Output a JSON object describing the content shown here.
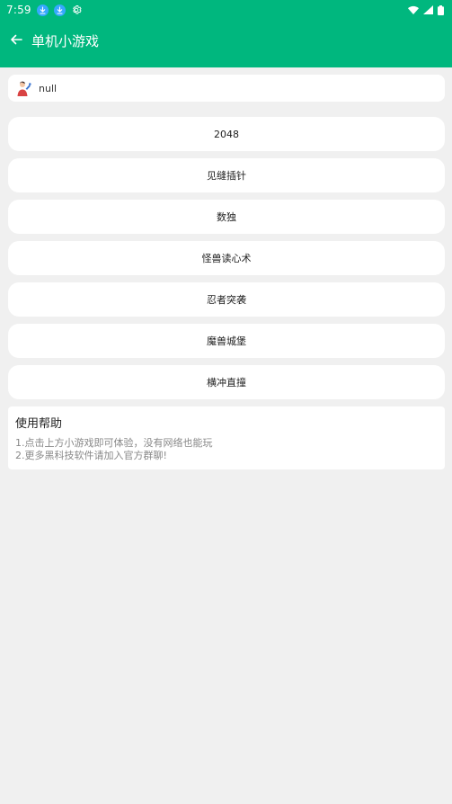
{
  "status_bar": {
    "time": "7:59",
    "notification_icons": [
      "download-icon",
      "download-icon",
      "gear-icon"
    ],
    "system_icons": [
      "wifi-icon",
      "signal-icon",
      "battery-icon"
    ]
  },
  "toolbar": {
    "back_icon": "arrow-back-icon",
    "title": "单机小游戏"
  },
  "user": {
    "avatar_icon": "person-avatar-icon",
    "name": "null"
  },
  "games": [
    {
      "label": "2048"
    },
    {
      "label": "见缝插针"
    },
    {
      "label": "数独"
    },
    {
      "label": "怪兽读心术"
    },
    {
      "label": "忍者突袭"
    },
    {
      "label": "魔兽城堡"
    },
    {
      "label": "横冲直撞"
    }
  ],
  "help": {
    "title": "使用帮助",
    "lines": [
      "1.点击上方小游戏即可体验，没有网络也能玩",
      "2.更多黑科技软件请加入官方群聊!"
    ]
  },
  "colors": {
    "accent": "#00b77e",
    "background": "#f0f0f0",
    "card": "#ffffff",
    "notification_badge": "#36a8ff"
  }
}
